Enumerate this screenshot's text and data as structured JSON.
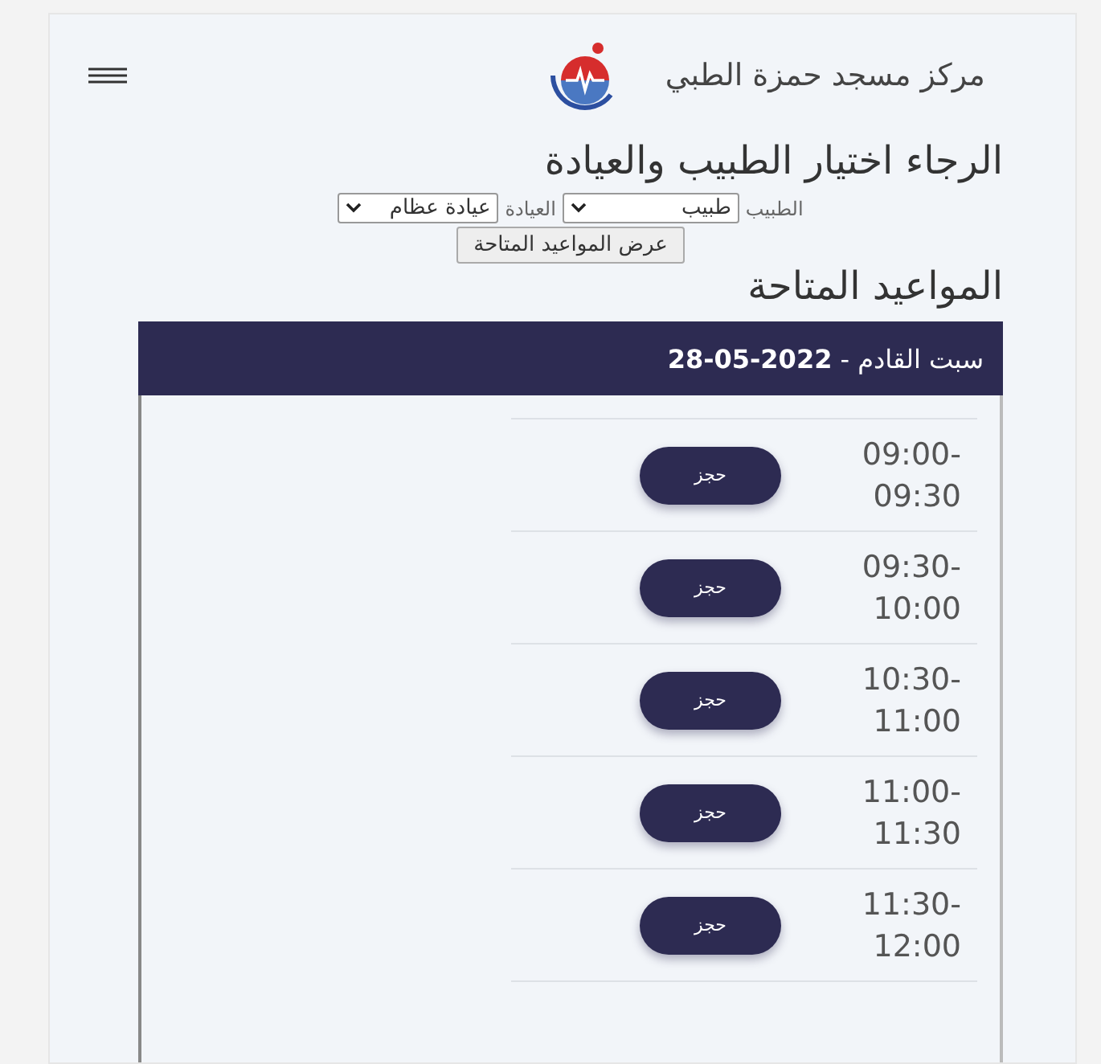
{
  "header": {
    "title": "مركز مسجد حمزة الطبي"
  },
  "form": {
    "heading": "الرجاء اختيار الطبيب والعيادة",
    "fields": [
      {
        "label": "الطبيب",
        "value": "طبيب"
      },
      {
        "label": "العيادة",
        "value": "عيادة عظام"
      }
    ],
    "submit": "عرض المواعيد المتاحة"
  },
  "appointments": {
    "heading": "المواعيد المتاحة",
    "day": "سبت القادم - **28-05-2022**",
    "slots": [
      {
        "time": "09:00-09:30",
        "action": "حجز"
      },
      {
        "time": "09:30-10:00",
        "action": "حجز"
      },
      {
        "time": "10:30-11:00",
        "action": "حجز"
      },
      {
        "time": "11:00-11:30",
        "action": "حجز"
      },
      {
        "time": "11:30-12:00",
        "action": "حجز"
      }
    ]
  }
}
